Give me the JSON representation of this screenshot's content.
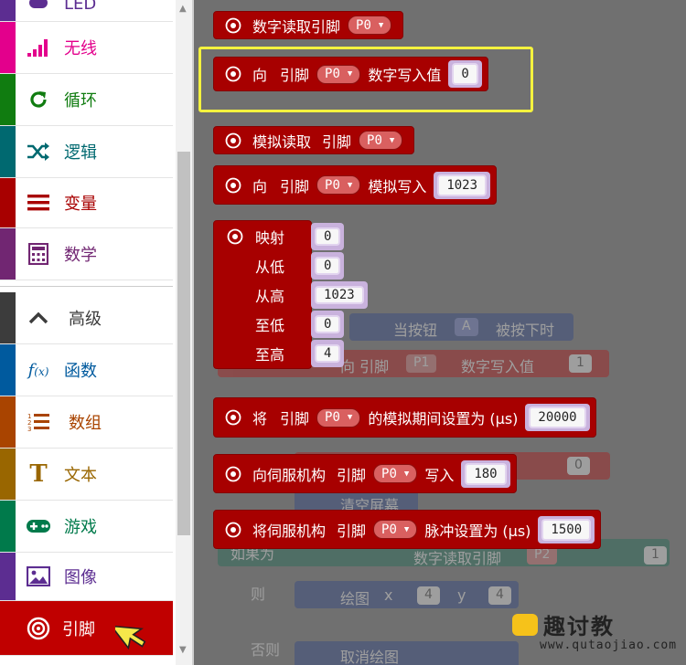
{
  "sidebar": {
    "categories": [
      {
        "label": "LED",
        "color": "#5c2d91",
        "icon": "led-icon"
      },
      {
        "label": "无线",
        "color": "#e3008c",
        "icon": "signal-bars-icon"
      },
      {
        "label": "循环",
        "color": "#107c10",
        "icon": "refresh-loop-icon"
      },
      {
        "label": "逻辑",
        "color": "#006970",
        "icon": "shuffle-logic-icon"
      },
      {
        "label": "变量",
        "color": "#a80000",
        "icon": "list-lines-icon"
      },
      {
        "label": "数学",
        "color": "#712672",
        "icon": "calculator-icon"
      },
      {
        "label": "高级",
        "color": "#3c3c3c",
        "icon": "chevron-up-icon"
      },
      {
        "label": "函数",
        "color": "#005a9e",
        "icon": "function-fx-icon"
      },
      {
        "label": "数组",
        "color": "#a94400",
        "icon": "numbered-list-icon"
      },
      {
        "label": "文本",
        "color": "#996600",
        "icon": "text-t-icon"
      },
      {
        "label": "游戏",
        "color": "#007a4b",
        "icon": "gamepad-icon"
      },
      {
        "label": "图像",
        "color": "#5c2d91",
        "icon": "image-icon"
      },
      {
        "label": "引脚",
        "color": "#a80000",
        "icon": "pin-target-icon",
        "selected": true
      }
    ]
  },
  "flyout": {
    "digital_read": {
      "label": "数字读取引脚",
      "pin": "P0"
    },
    "digital_write": {
      "label_to": "向",
      "label_pin": "引脚",
      "pin": "P0",
      "label_value": "数字写入值",
      "value": "0"
    },
    "analog_read": {
      "label": "模拟读取",
      "label_pin": "引脚",
      "pin": "P0"
    },
    "analog_write": {
      "label_to": "向",
      "label_pin": "引脚",
      "pin": "P0",
      "label_value": "模拟写入",
      "value": "1023"
    },
    "map": {
      "label": "映射",
      "value": "0",
      "from_low_label": "从低",
      "from_low": "0",
      "from_high_label": "从高",
      "from_high": "1023",
      "to_low_label": "至低",
      "to_low": "0",
      "to_high_label": "至高",
      "to_high": "4"
    },
    "analog_period": {
      "label_set": "将",
      "label_pin": "引脚",
      "pin": "P0",
      "label_value": "的模拟期间设置为 (µs)",
      "value": "20000"
    },
    "servo_write": {
      "label": "向伺服机构",
      "label_pin": "引脚",
      "pin": "P0",
      "label_value": "写入",
      "value": "180"
    },
    "servo_pulse": {
      "label": "将伺服机构",
      "label_pin": "引脚",
      "pin": "P0",
      "label_value": "脉冲设置为 (µs)",
      "value": "1500"
    }
  },
  "background_ghost": {
    "on_button": {
      "label": "当按钮",
      "button": "A",
      "suffix": "被按下时"
    },
    "write_ghost": {
      "label": "向 引脚",
      "pin": "P1",
      "value_label": "数字写入值",
      "value": "1"
    },
    "clear_screen": "清空屏幕",
    "if_label": "如果为",
    "read_ghost": {
      "label": "数字读取引脚",
      "pin": "P2",
      "value": "1"
    },
    "then_label": "则",
    "plot": {
      "label": "绘图",
      "x_label": "x",
      "x": "4",
      "y_label": "y",
      "y": "4"
    },
    "else_label": "否则",
    "unplot": "取消绘图",
    "zero": "0"
  },
  "watermark": {
    "brand": "趣讨教",
    "url": "www.qutaojiao.com"
  },
  "colors": {
    "pins": "#a70000",
    "highlight": "#f4f23e",
    "workspace": "#707070"
  }
}
